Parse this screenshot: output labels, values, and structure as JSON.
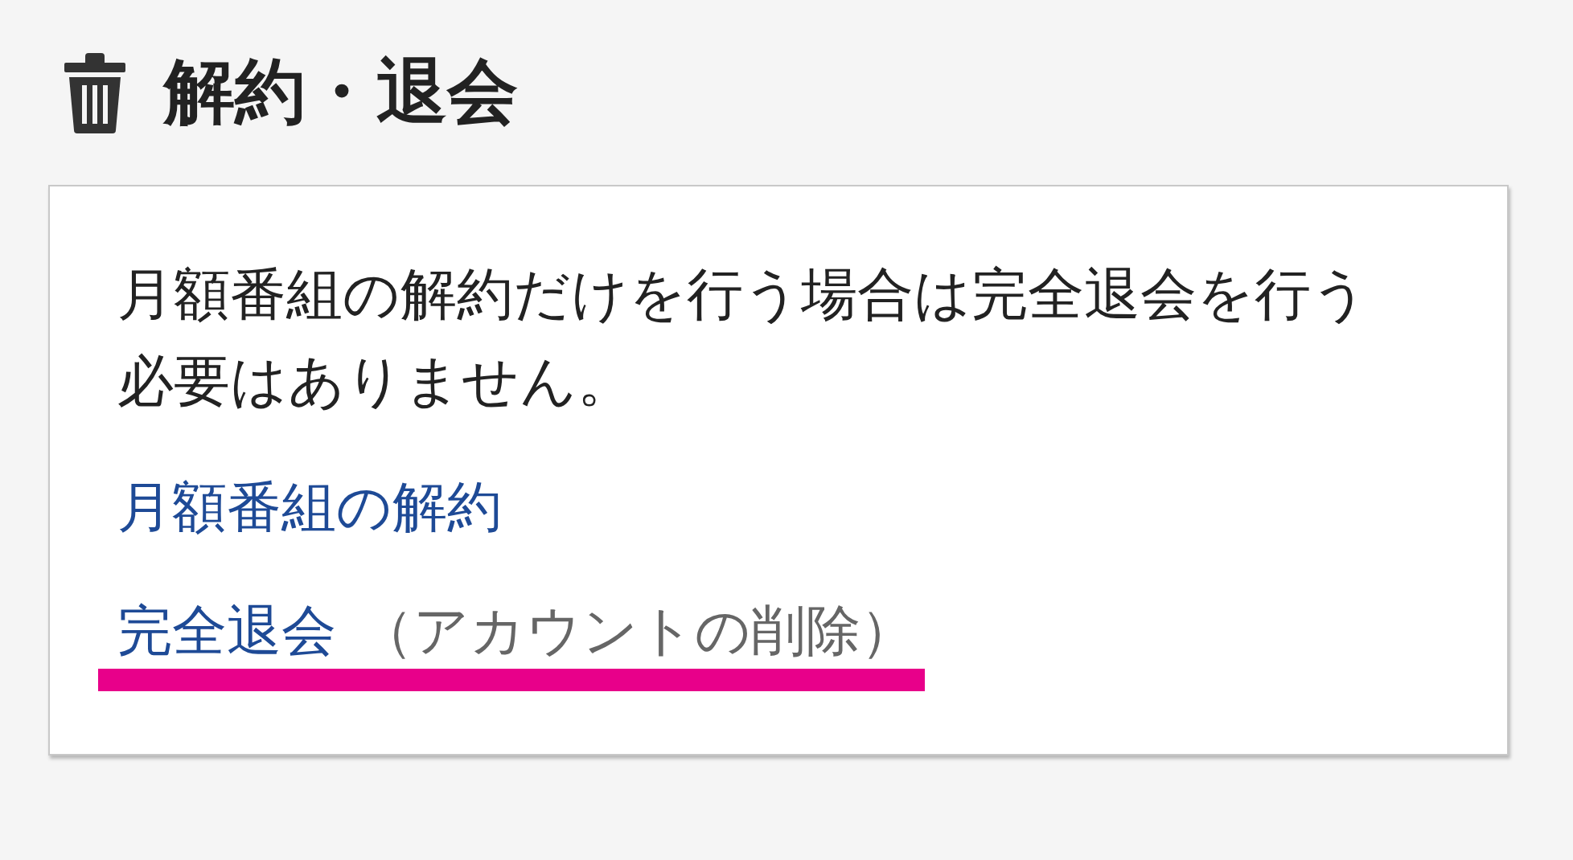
{
  "heading": {
    "title": "解約・退会"
  },
  "card": {
    "message": "月額番組の解約だけを行う場合は完全退会を行う必要はありません。",
    "links": [
      {
        "text": "月額番組の解約",
        "highlighted": false
      },
      {
        "text": "完全退会",
        "note": "（アカウントの削除）",
        "highlighted": true
      }
    ]
  }
}
